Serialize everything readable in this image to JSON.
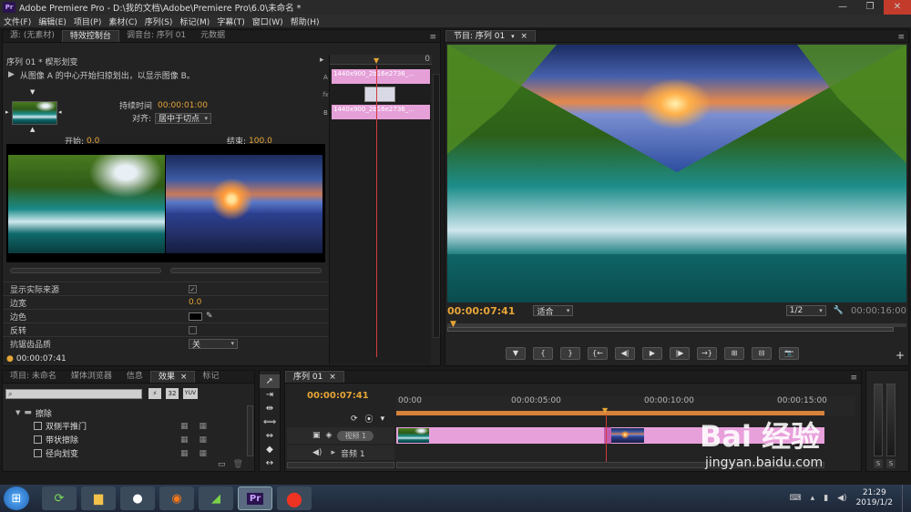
{
  "window": {
    "title": "Adobe Premiere Pro - D:\\我的文档\\Adobe\\Premiere Pro\\6.0\\未命名 *",
    "app_icon": "Pr",
    "controls": [
      "—",
      "❐",
      "✕"
    ]
  },
  "menu": [
    "文件(F)",
    "编辑(E)",
    "项目(P)",
    "素材(C)",
    "序列(S)",
    "标记(M)",
    "字幕(T)",
    "窗口(W)",
    "帮助(H)"
  ],
  "source_panel": {
    "tabs": [
      "源: (无素材)",
      "特效控制台",
      "调音台: 序列 01",
      "元数据"
    ],
    "active_tab": "特效控制台",
    "header": "序列 01 * 楔形划变",
    "timeline_zero": "0",
    "description": "从图像 A 的中心开始扫掠划出，以显示图像 B。",
    "duration_label": "持续时间",
    "duration_value": "00:00:01:00",
    "align_label": "对齐:",
    "align_value": "居中于切点",
    "start_label": "开始:",
    "start_value": "0.0",
    "end_label": "结束:",
    "end_value": "100.0",
    "clip_a_label": "1440x900_2b16e2736_...",
    "clip_a_tag": "A",
    "clip_b_label": "1440x900_2b16e2736_...",
    "clip_b_tag": "B",
    "properties": [
      {
        "label": "显示实际来源",
        "value": "✓"
      },
      {
        "label": "边宽",
        "value": "0.0"
      },
      {
        "label": "边色",
        "value": ""
      },
      {
        "label": "反转",
        "value": ""
      },
      {
        "label": "抗锯齿品质",
        "value": "关"
      }
    ],
    "timecode": "00:00:07:41"
  },
  "program_panel": {
    "tab": "节目: 序列 01",
    "timecode": "00:00:07:41",
    "fit": "适合",
    "resolution": "1/2",
    "duration": "00:00:16:00",
    "transport": [
      "▼",
      "{",
      "}",
      "{←",
      "◀|",
      "▶",
      "|▶",
      "→}",
      "⊞",
      "⊟",
      "📷"
    ],
    "add": "+"
  },
  "project_panel": {
    "tabs": [
      "项目: 未命名",
      "媒体浏览器",
      "信息",
      "效果",
      "标记"
    ],
    "active_tab": "效果",
    "search_placeholder": "",
    "badges": [
      "32",
      "YUV"
    ],
    "folder": "擦除",
    "items": [
      "双侧平推门",
      "带状擦除",
      "径向划变"
    ]
  },
  "timeline_panel": {
    "tab": "序列 01",
    "timecode": "00:00:07:41",
    "ruler": [
      "00:00",
      "00:00:05:00",
      "00:00:10:00",
      "00:00:15:00"
    ],
    "audio_track": "音频 1",
    "video_track": "视频 1"
  },
  "meters": {
    "labels": [
      "S",
      "S"
    ]
  },
  "taskbar": {
    "time": "21:29",
    "date": "2019/1/2",
    "apps": [
      "start",
      "refresh",
      "explorer",
      "qq",
      "firefox",
      "camtasia",
      "premiere",
      "recorder"
    ]
  },
  "watermark": {
    "brand": "Bai 经验",
    "url": "jingyan.baidu.com"
  }
}
